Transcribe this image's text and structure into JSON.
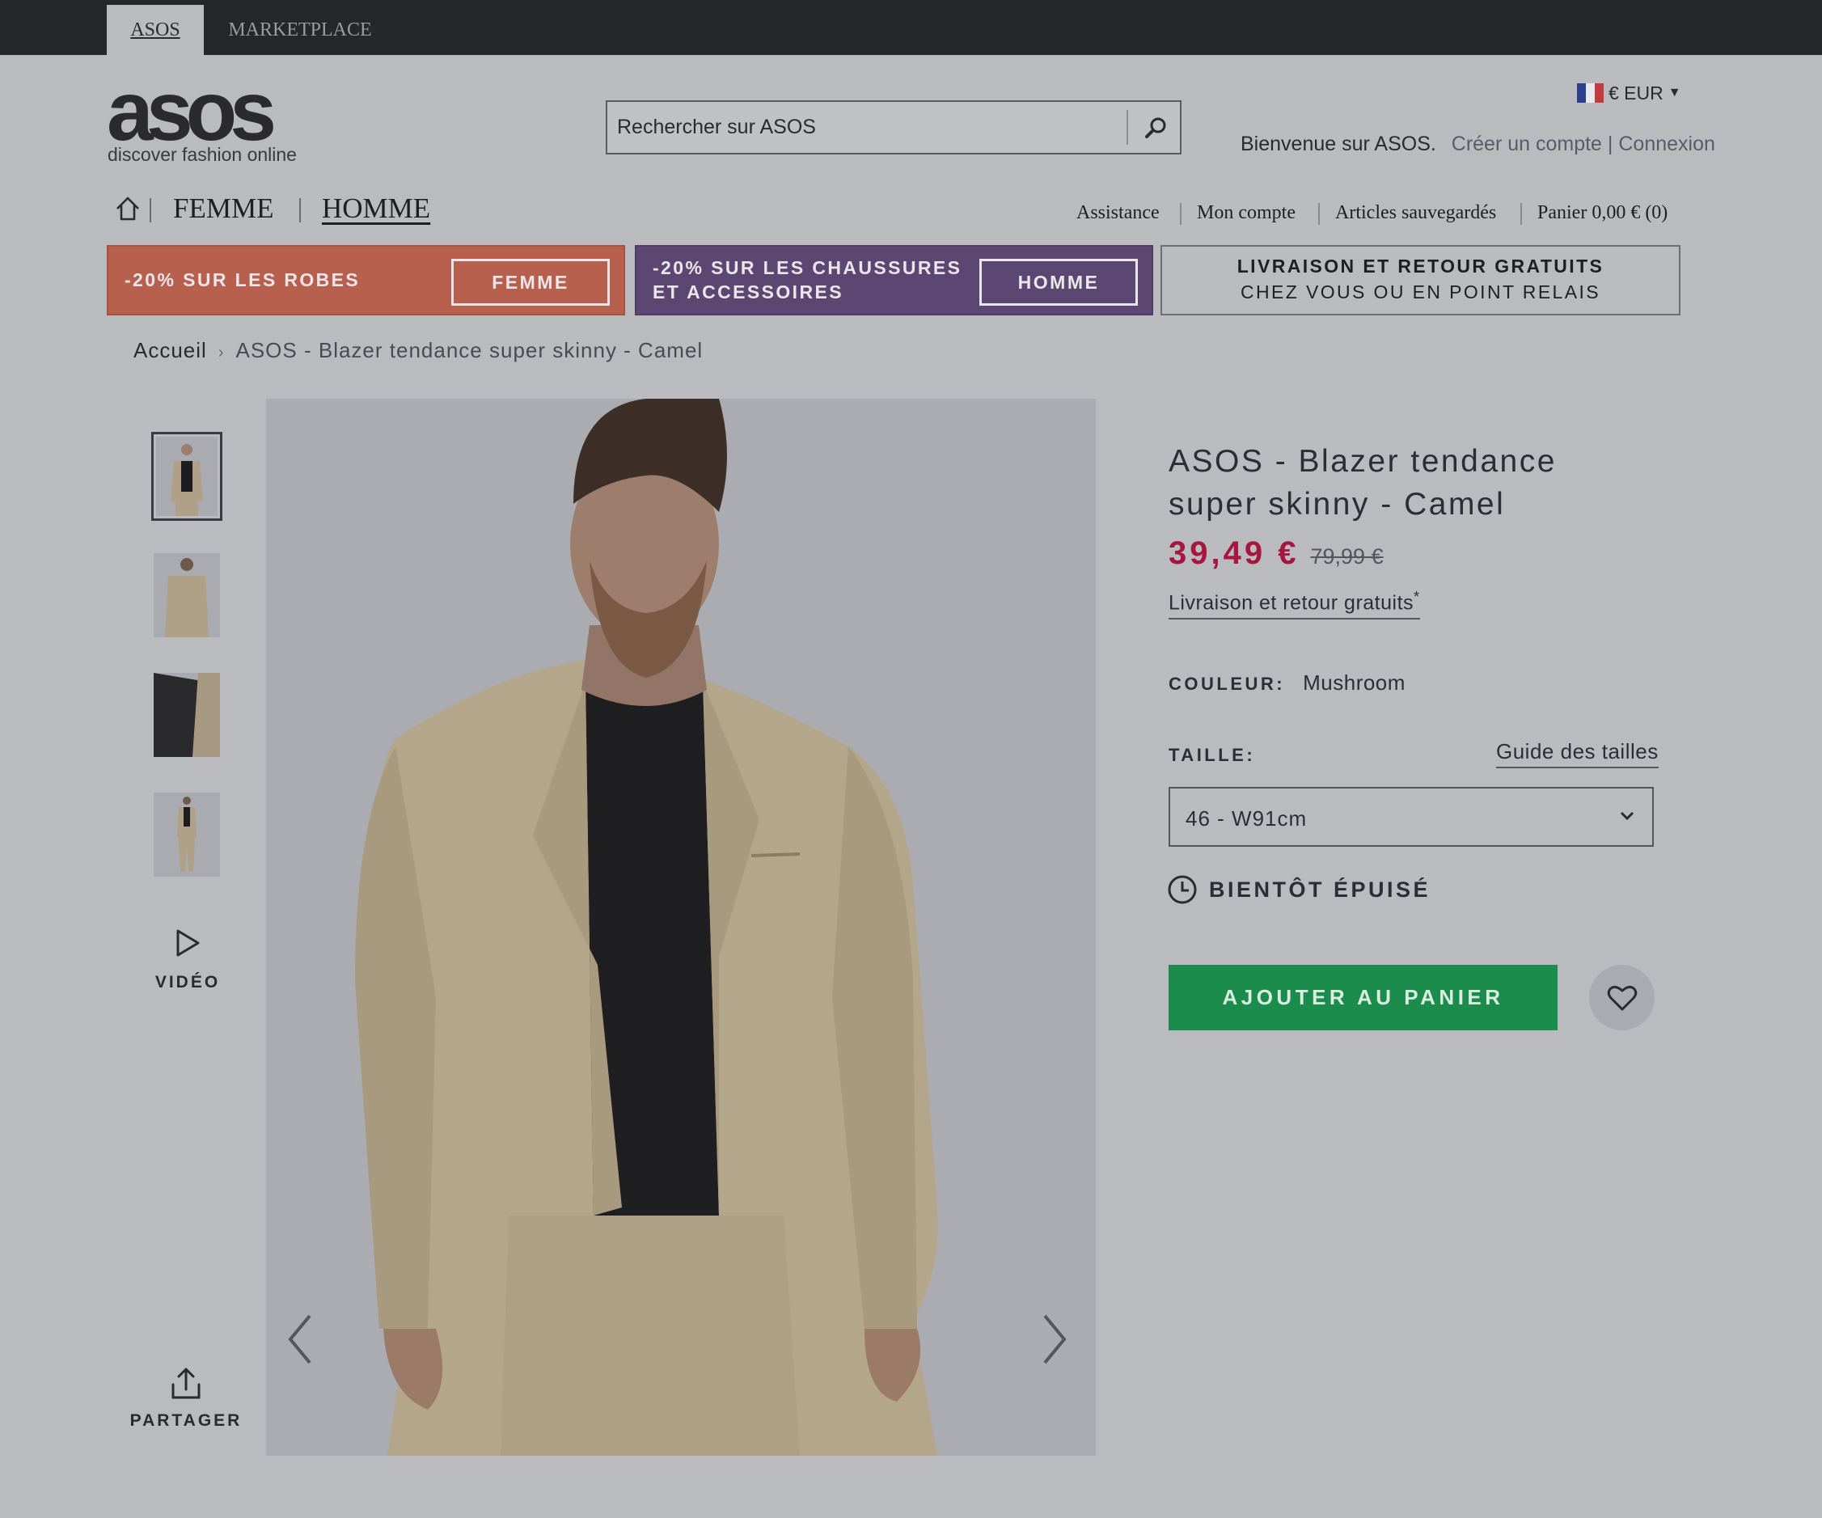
{
  "topbar": {
    "tabs": [
      "ASOS",
      "MARKETPLACE"
    ]
  },
  "header": {
    "logo_word": "asos",
    "logo_tagline": "discover fashion online",
    "search_placeholder": "Rechercher sur ASOS",
    "currency": "€ EUR",
    "welcome": "Bienvenue sur ASOS.",
    "create_account": "Créer un compte",
    "account_sep": "|",
    "login": "Connexion"
  },
  "nav": {
    "femme": "FEMME",
    "homme": "HOMME",
    "utility": [
      "Assistance",
      "Mon compte",
      "Articles sauvegardés",
      "Panier 0,00 € (0)"
    ]
  },
  "promos": {
    "red": {
      "text": "-20% SUR LES ROBES",
      "button": "FEMME",
      "color": "#b8604e"
    },
    "purple": {
      "text_line1": "-20% SUR LES CHAUSSURES",
      "text_line2": "ET ACCESSOIRES",
      "button": "HOMME",
      "color": "#5c4672"
    },
    "delivery": {
      "line1": "LIVRAISON ET RETOUR GRATUITS",
      "line2": "CHEZ VOUS OU EN POINT RELAIS"
    }
  },
  "breadcrumb": {
    "home": "Accueil",
    "sep": "›",
    "current": "ASOS - Blazer tendance super skinny - Camel"
  },
  "gallery": {
    "thumb_count": 4,
    "video_label": "VIDÉO",
    "share_label": "PARTAGER",
    "prev_icon": "chevron-left-icon",
    "next_icon": "chevron-right-icon"
  },
  "product": {
    "title": "ASOS - Blazer tendance super skinny - Camel",
    "price": "39,49 €",
    "old_price": "79,99 €",
    "price_color": "#a6163f",
    "shipping": "Livraison et retour gratuits",
    "shipping_mark": "*",
    "color_label": "COULEUR:",
    "color_value": "Mushroom",
    "size_label": "TAILLE:",
    "size_guide": "Guide des tailles",
    "size_value": "46 - W91cm",
    "stock": "BIENTÔT ÉPUISÉ",
    "add_to_cart": "AJOUTER AU PANIER",
    "cta_color": "#1c8c4d"
  }
}
